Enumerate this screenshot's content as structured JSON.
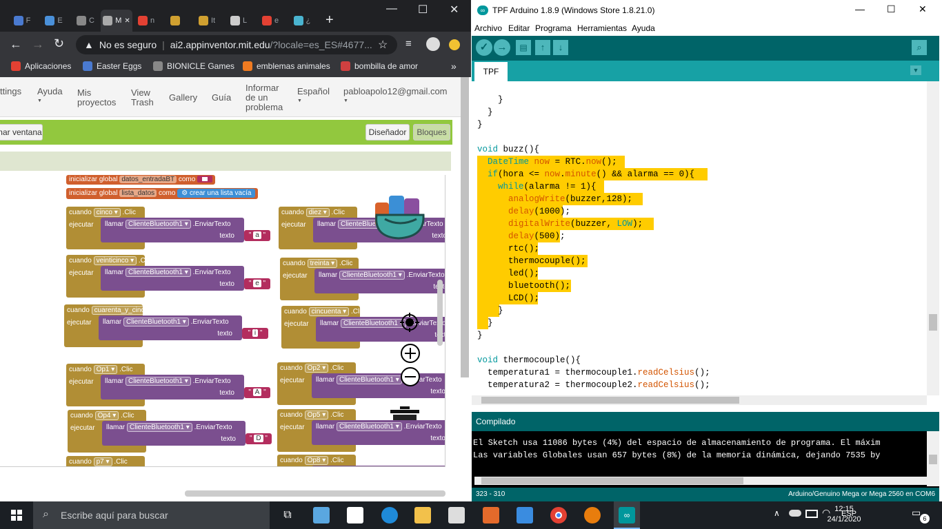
{
  "browser": {
    "tabs": [
      {
        "label": "F",
        "color": "#4a7ad0"
      },
      {
        "label": "E",
        "color": "#4a90d9"
      },
      {
        "label": "C",
        "color": "#888888"
      },
      {
        "label": "M",
        "color": "#aaaaaa",
        "active": true
      },
      {
        "label": "n",
        "color": "#e34133"
      },
      {
        "label": "",
        "color": "#d0a030"
      },
      {
        "label": "It",
        "color": "#d0a030"
      },
      {
        "label": "L",
        "color": "#cccccc"
      },
      {
        "label": "e",
        "color": "#e34133"
      },
      {
        "label": "¿",
        "color": "#4ab4d0"
      }
    ],
    "new_tab": "+",
    "window_controls": [
      "—",
      "☐",
      "✕"
    ],
    "security_label": "No es seguro",
    "url_domain": "ai2.appinventor.mit.edu",
    "url_rest": "/?locale=es_ES#4677...",
    "bookmarks": [
      {
        "label": "Aplicaciones",
        "color": "#e34133"
      },
      {
        "label": "Easter Eggs",
        "color": "#4a7ad0"
      },
      {
        "label": "BIONICLE Games",
        "color": "#888888"
      },
      {
        "label": "emblemas animales",
        "color": "#f07b21"
      },
      {
        "label": "bombilla de amor",
        "color": "#d04040"
      }
    ],
    "bookmarks_more": "»"
  },
  "appinventor": {
    "nav": {
      "settings": "ttings",
      "help": "Ayuda",
      "my_projects": "Mis\nproyectos",
      "view_trash": "View\nTrash",
      "gallery": "Gallery",
      "guide": "Guía",
      "report": "Informar\nde un\nproblema",
      "language": "Español",
      "account": "pabloapolo12@gmail.com"
    },
    "screen_button": "nar ventana",
    "designer_button": "Diseñador",
    "blocks_button": "Bloques",
    "blocks": {
      "init1": {
        "kw": "inicializar global",
        "name": "datos_entradaBT",
        "as": "como"
      },
      "init2": {
        "kw": "inicializar global",
        "name": "lista_datos",
        "as": "como",
        "value": "crear una lista vacía"
      },
      "when": "cuando",
      "do": "ejecutar",
      "call": "llamar",
      "component": "ClienteBluetooth1",
      "method": ".EnviarTexto",
      "text_param": "texto",
      "click": ".Clic",
      "events": [
        {
          "button": "cinco",
          "text": "a"
        },
        {
          "button": "diez",
          "text": ""
        },
        {
          "button": "veinticinco",
          "text": "e"
        },
        {
          "button": "treinta",
          "text": ""
        },
        {
          "button": "cuarenta_y_cinco",
          "text": "i"
        },
        {
          "button": "cincuenta",
          "text": ""
        },
        {
          "button": "Op1",
          "text": "A"
        },
        {
          "button": "Op2",
          "text": ""
        },
        {
          "button": "Op4",
          "text": "D"
        },
        {
          "button": "Op5",
          "text": ""
        },
        {
          "button": "p7",
          "text": ""
        },
        {
          "button": "Op8",
          "text": ""
        }
      ]
    }
  },
  "arduino": {
    "title": "TPF Arduino 1.8.9 (Windows Store 1.8.21.0)",
    "menu": [
      "Archivo",
      "Editar",
      "Programa",
      "Herramientas",
      "Ayuda"
    ],
    "tab": "TPF",
    "code_lines": [
      "    }",
      "  }",
      "}",
      "",
      "void buzz(){",
      "  DateTime now = RTC.now();",
      "  if(hora <= now.minute() && alarma == 0){",
      "    while(alarma != 1){",
      "      analogWrite(buzzer,128);",
      "      delay(1000);",
      "      digitalWrite(buzzer, LOW);",
      "      delay(500);",
      "      rtc();",
      "      thermocouple();",
      "      led();",
      "      bluetooth();",
      "      LCD();",
      "    }",
      "  }",
      "}",
      "",
      "void thermocouple(){",
      "  temperatura1 = thermocouple1.readCelsius();",
      "  temperatura2 = thermocouple2.readCelsius();"
    ],
    "status": "Compilado",
    "console": [
      "El Sketch usa 11086 bytes (4%) del espacio de almacenamiento de programa. El máxim",
      "Las variables Globales usan 657 bytes (8%) de la memoria dinámica, dejando 7535 by"
    ],
    "cursor_pos": "323 - 310",
    "board": "Arduino/Genuino Mega or Mega 2560 en COM6",
    "window_controls": [
      "—",
      "☐",
      "✕"
    ]
  },
  "taskbar": {
    "search_placeholder": "Escribe aquí para buscar",
    "language": "ESP",
    "time": "12:15",
    "date": "24/1/2020",
    "notifications": "6"
  }
}
